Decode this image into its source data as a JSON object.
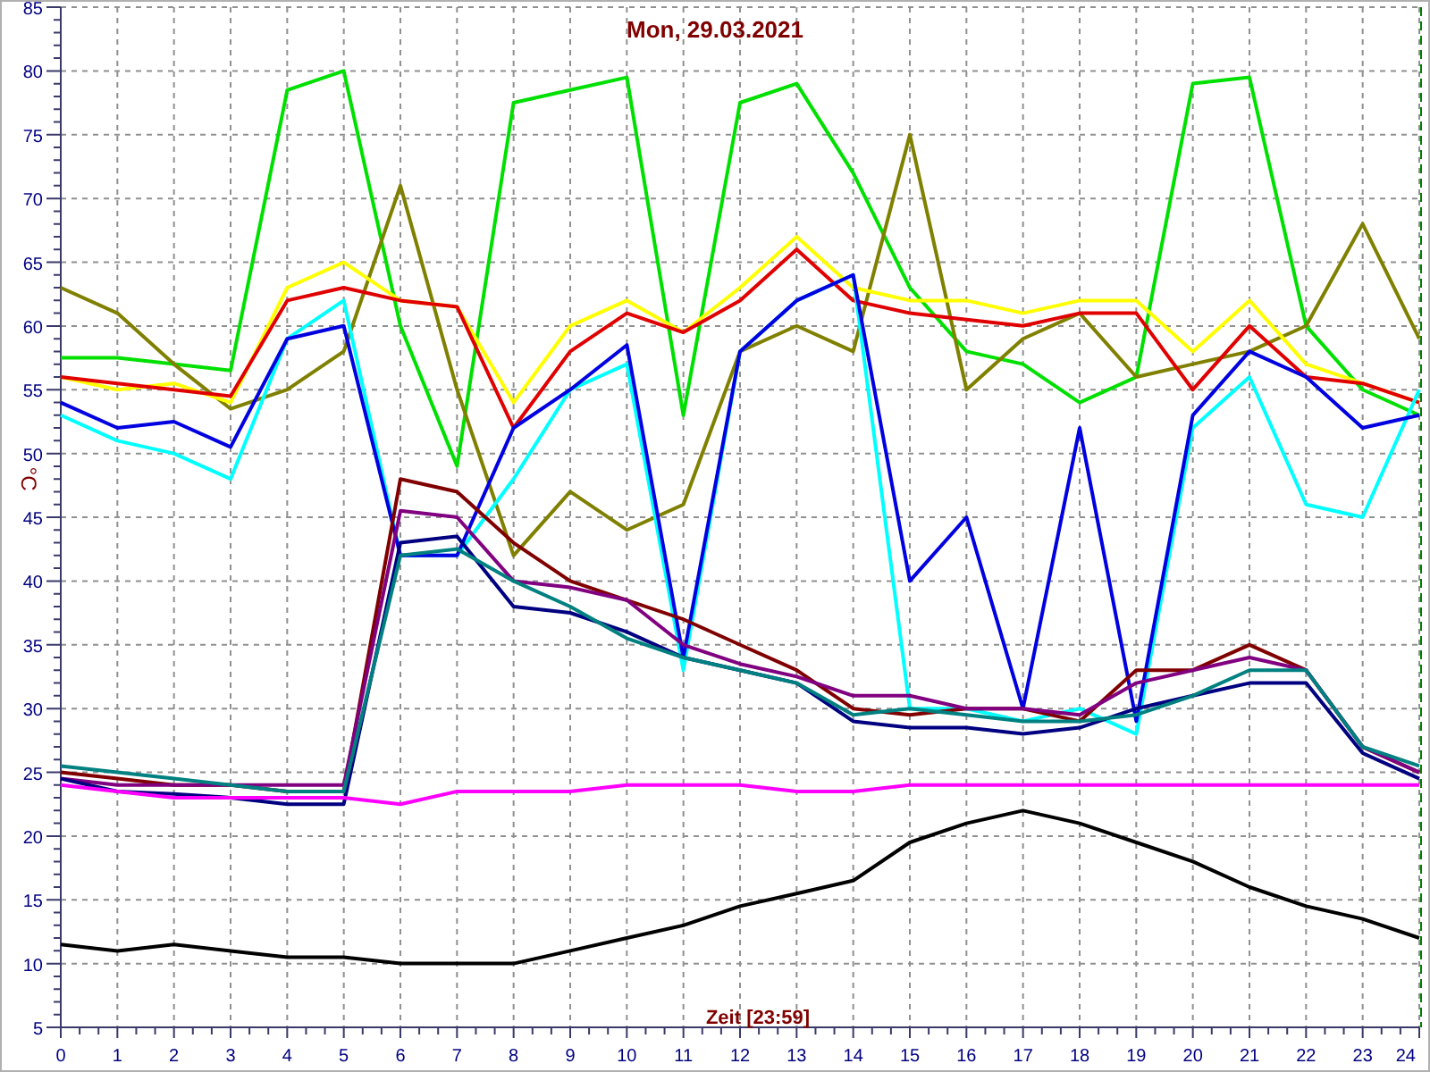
{
  "chart_data": {
    "type": "line",
    "grid": true,
    "title": "Mon, 29.03.2021",
    "xlabel": "Zeit [23:59]",
    "ylabel": "°C",
    "xlim": [
      0,
      24
    ],
    "ylim": [
      5,
      85
    ],
    "xticks": [
      0,
      1,
      2,
      3,
      4,
      5,
      6,
      7,
      8,
      9,
      10,
      11,
      12,
      13,
      14,
      15,
      16,
      17,
      18,
      19,
      20,
      21,
      22,
      23,
      24
    ],
    "yticks": [
      5,
      10,
      15,
      20,
      25,
      30,
      35,
      40,
      45,
      50,
      55,
      60,
      65,
      70,
      75,
      80,
      85
    ],
    "x": [
      0,
      1,
      2,
      3,
      4,
      5,
      6,
      7,
      8,
      9,
      10,
      11,
      12,
      13,
      14,
      15,
      16,
      17,
      18,
      19,
      20,
      21,
      22,
      23,
      24
    ],
    "series": [
      {
        "color": "#00e000",
        "values": [
          57.5,
          57.5,
          57,
          56.5,
          78.5,
          80,
          60,
          49,
          77.5,
          78.5,
          79.5,
          53,
          77.5,
          79,
          72,
          63,
          58,
          57,
          54,
          56,
          79,
          79.5,
          60,
          55,
          53
        ]
      },
      {
        "color": "#808000",
        "values": [
          63,
          61,
          57,
          53.5,
          55,
          58,
          71,
          55,
          42,
          47,
          44,
          46,
          58,
          60,
          58,
          75,
          55,
          59,
          61,
          56,
          57,
          58,
          60,
          68,
          59
        ]
      },
      {
        "color": "#ffff00",
        "values": [
          56,
          55,
          55.5,
          54,
          63,
          65,
          62,
          61.5,
          54,
          60,
          62,
          59.5,
          63,
          67,
          63,
          62,
          62,
          61,
          62,
          62,
          58,
          62,
          57,
          55.5,
          54
        ]
      },
      {
        "color": "#e00000",
        "values": [
          56,
          55.5,
          55,
          54.5,
          62,
          63,
          62,
          61.5,
          52,
          58,
          61,
          59.5,
          62,
          66,
          62,
          61,
          60.5,
          60,
          61,
          61,
          55,
          60,
          56,
          55.5,
          54
        ]
      },
      {
        "color": "#00ffff",
        "values": [
          53,
          51,
          50,
          48,
          59,
          62,
          42,
          42,
          48,
          55,
          57,
          33,
          58,
          62,
          64,
          30,
          30,
          29,
          30,
          28,
          52,
          56,
          46,
          45,
          55
        ]
      },
      {
        "color": "#0000e0",
        "values": [
          54,
          52,
          52.5,
          50.5,
          59,
          60,
          42,
          42,
          52,
          55,
          58.5,
          34,
          58,
          62,
          64,
          40,
          45,
          30,
          52,
          29,
          53,
          58,
          56,
          52,
          53
        ]
      },
      {
        "color": "#800000",
        "values": [
          25,
          24.5,
          24,
          24,
          23.5,
          23.5,
          48,
          47,
          43,
          40,
          38.5,
          37,
          35,
          33,
          30,
          29.5,
          30,
          30,
          29,
          33,
          33,
          35,
          33,
          27,
          25
        ]
      },
      {
        "color": "#800080",
        "values": [
          24.5,
          24,
          24,
          24,
          24,
          24,
          45.5,
          45,
          40,
          39.5,
          38.5,
          35,
          33.5,
          32.5,
          31,
          31,
          30,
          30,
          29.5,
          32,
          33,
          34,
          33,
          27,
          25
        ]
      },
      {
        "color": "#000080",
        "values": [
          24.5,
          23.5,
          23.3,
          23,
          22.5,
          22.5,
          43,
          43.5,
          38,
          37.5,
          36,
          34,
          33,
          32,
          29,
          28.5,
          28.5,
          28,
          28.5,
          30,
          31,
          32,
          32,
          26.5,
          24.5
        ]
      },
      {
        "color": "#008080",
        "values": [
          25.5,
          25,
          24.5,
          24,
          23.5,
          23.5,
          42,
          42.5,
          40,
          38,
          35.5,
          34,
          33,
          32,
          29.5,
          30,
          29.5,
          29,
          29,
          29.5,
          31,
          33,
          33,
          27,
          25.5
        ]
      },
      {
        "color": "#ff00ff",
        "values": [
          24,
          23.5,
          23,
          23,
          23,
          23,
          22.5,
          23.5,
          23.5,
          23.5,
          24,
          24,
          24,
          23.5,
          23.5,
          24,
          24,
          24,
          24,
          24,
          24,
          24,
          24,
          24,
          24
        ]
      },
      {
        "color": "#000000",
        "values": [
          11.5,
          11,
          11.5,
          11,
          10.5,
          10.5,
          10,
          10,
          10,
          11,
          12,
          13,
          14.5,
          15.5,
          16.5,
          19.5,
          21,
          22,
          21,
          19.5,
          18,
          16,
          14.5,
          13.5,
          12
        ]
      }
    ]
  }
}
